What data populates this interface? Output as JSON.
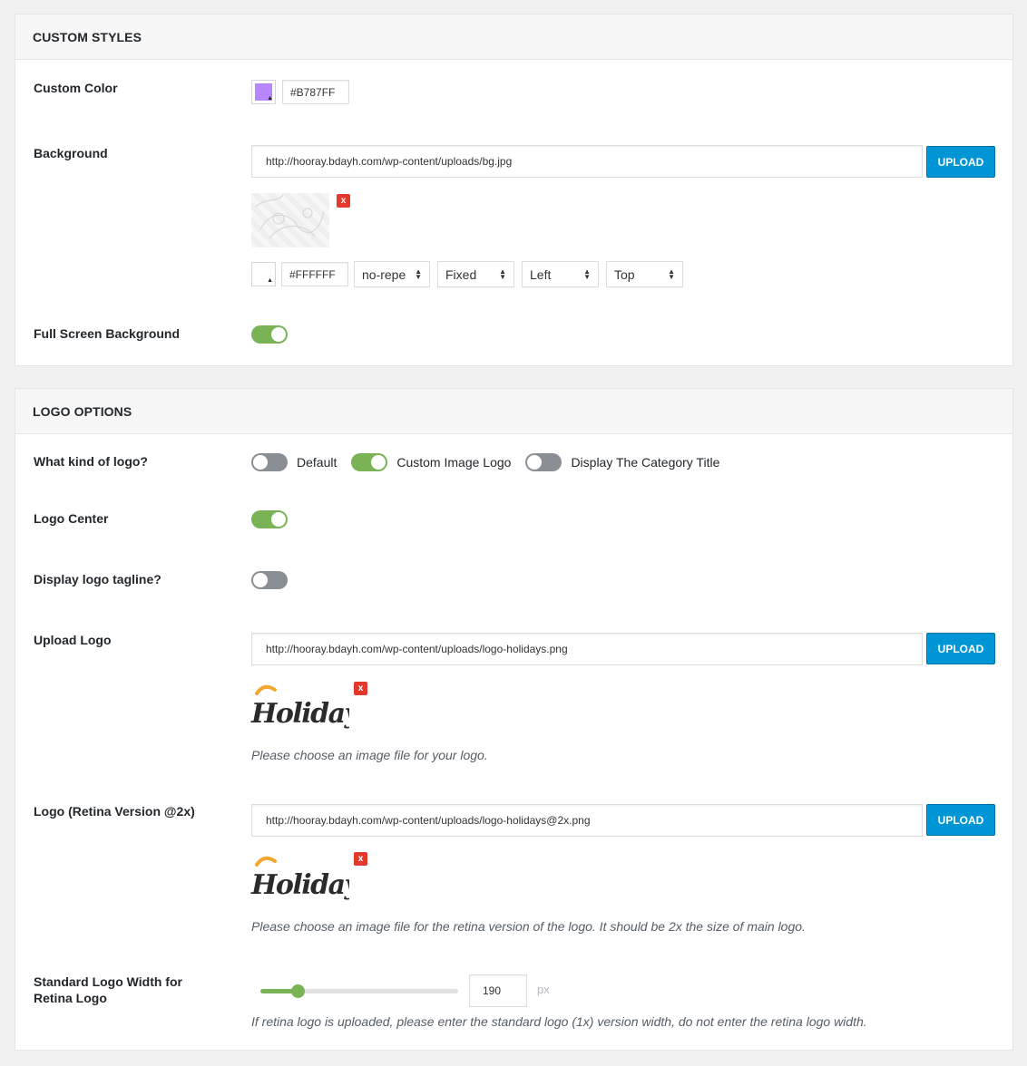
{
  "custom_styles": {
    "title": "CUSTOM STYLES",
    "custom_color": {
      "label": "Custom Color",
      "value": "#B787FF",
      "swatch_color": "#B787FF"
    },
    "background": {
      "label": "Background",
      "url": "http://hooray.bdayh.com/wp-content/uploads/bg.jpg",
      "upload_label": "UPLOAD",
      "remove_label": "x",
      "color_value": "#FFFFFF",
      "swatch_color": "#FFFFFF",
      "repeat": "no-repe",
      "attachment": "Fixed",
      "position_x": "Left",
      "position_y": "Top"
    },
    "full_screen": {
      "label": "Full Screen Background",
      "state": "on"
    }
  },
  "logo_options": {
    "title": "LOGO OPTIONS",
    "kind": {
      "label": "What kind of logo?",
      "options": [
        {
          "label": "Default",
          "state": "off"
        },
        {
          "label": "Custom Image Logo",
          "state": "on"
        },
        {
          "label": "Display The Category Title",
          "state": "off"
        }
      ]
    },
    "center": {
      "label": "Logo Center",
      "state": "on"
    },
    "tagline": {
      "label": "Display logo tagline?",
      "state": "off"
    },
    "upload_logo": {
      "label": "Upload Logo",
      "url": "http://hooray.bdayh.com/wp-content/uploads/logo-holidays.png",
      "upload_label": "UPLOAD",
      "remove_label": "x",
      "logo_text": "Holidays",
      "description": "Please choose an image file for your logo."
    },
    "retina_logo": {
      "label": "Logo (Retina Version @2x)",
      "url": "http://hooray.bdayh.com/wp-content/uploads/logo-holidays@2x.png",
      "upload_label": "UPLOAD",
      "remove_label": "x",
      "logo_text": "Holidays",
      "description": "Please choose an image file for the retina version of the logo. It should be 2x the size of main logo."
    },
    "logo_width": {
      "label": "Standard Logo Width for Retina Logo",
      "value": "190",
      "unit": "px",
      "slider_fraction": 0.19,
      "description": "If retina logo is uploaded, please enter the standard logo (1x) version width, do not enter the retina logo width."
    }
  },
  "colors": {
    "toggle_on": "#7ab356",
    "toggle_off": "#8a8f96",
    "accent": "#0096d6",
    "remove": "#e3392d",
    "logo_sun": "#f0a830"
  }
}
